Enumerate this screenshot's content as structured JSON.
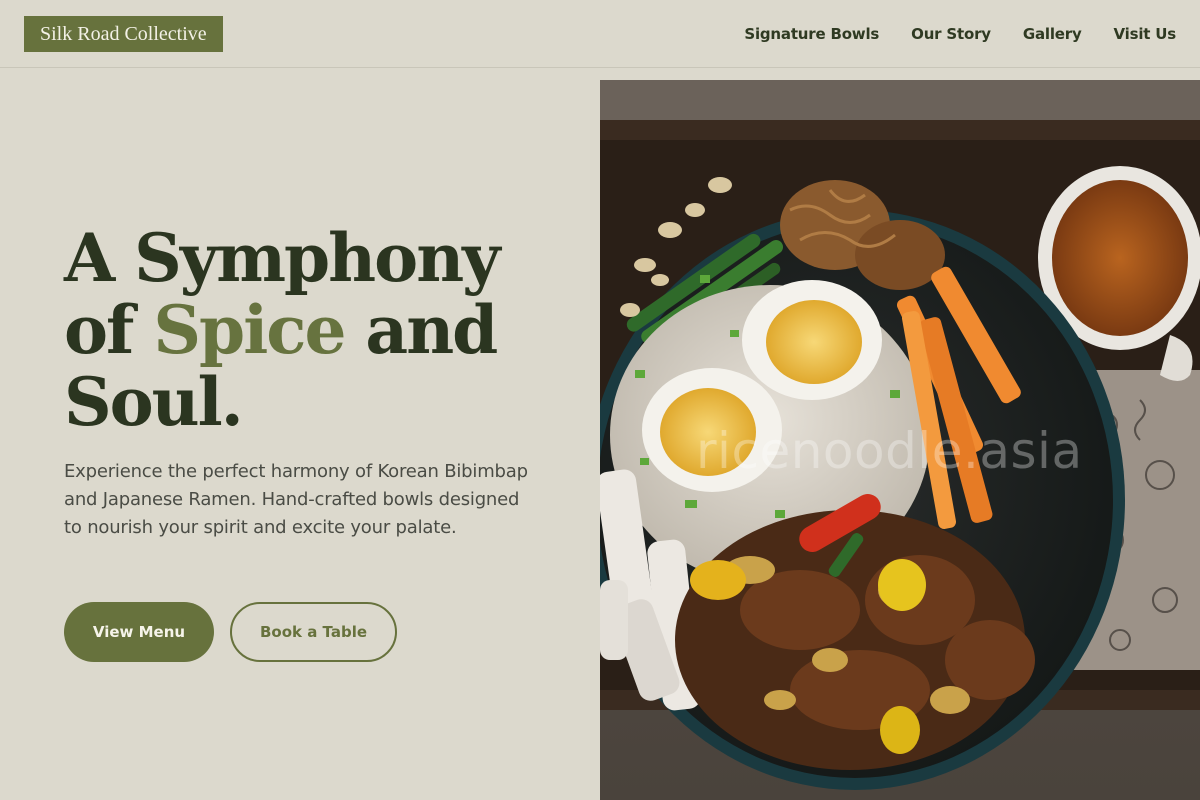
{
  "nav": {
    "logo": "Silk Road Collective",
    "links": [
      "Signature Bowls",
      "Our Story",
      "Gallery",
      "Visit Us"
    ]
  },
  "hero": {
    "title_line1": "A Symphony",
    "title_of": "of ",
    "title_accent": "Spice",
    "title_and": " and",
    "title_line3": "Soul.",
    "description": "Experience the perfect harmony of Korean Bibimbap and Japanese Ramen. Hand-crafted bowls designed to nourish your spirit and excite your palate.",
    "primary_button": "View Menu",
    "secondary_button": "Book a Table"
  },
  "image": {
    "watermark": "ricenoodle.asia"
  },
  "colors": {
    "background": "#dcd9cd",
    "accent": "#67723d",
    "heading": "#2b3520",
    "body_text": "#4a4c45"
  }
}
